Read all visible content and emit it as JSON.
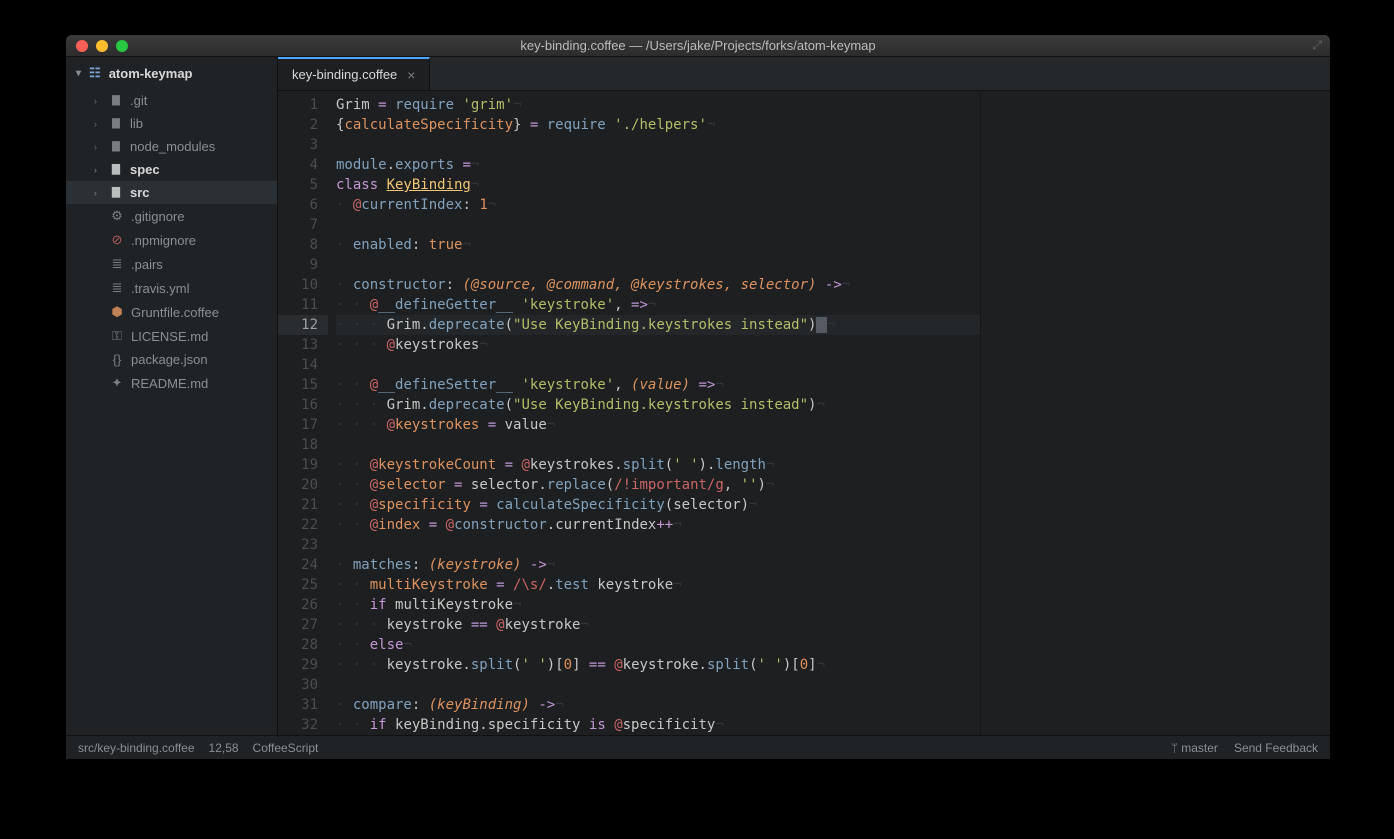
{
  "window": {
    "title": "key-binding.coffee — /Users/jake/Projects/forks/atom-keymap"
  },
  "sidebar": {
    "project": "atom-keymap",
    "items": [
      {
        "type": "folder",
        "label": ".git",
        "expanded": false
      },
      {
        "type": "folder",
        "label": "lib",
        "expanded": false
      },
      {
        "type": "folder",
        "label": "node_modules",
        "expanded": false
      },
      {
        "type": "folder",
        "label": "spec",
        "expanded": false,
        "bold": true
      },
      {
        "type": "folder",
        "label": "src",
        "expanded": false,
        "bold": true,
        "selected": true
      },
      {
        "type": "file",
        "label": ".gitignore",
        "icon": "⚙"
      },
      {
        "type": "file",
        "label": ".npmignore",
        "icon": "⊘",
        "iconcolor": "#cc6666"
      },
      {
        "type": "file",
        "label": ".pairs",
        "icon": "≣"
      },
      {
        "type": "file",
        "label": ".travis.yml",
        "icon": "≣"
      },
      {
        "type": "file",
        "label": "Gruntfile.coffee",
        "icon": "⬢",
        "iconcolor": "#de935f"
      },
      {
        "type": "file",
        "label": "LICENSE.md",
        "icon": "⚿"
      },
      {
        "type": "file",
        "label": "package.json",
        "icon": "{}"
      },
      {
        "type": "file",
        "label": "README.md",
        "icon": "✦"
      }
    ]
  },
  "tab": {
    "label": "key-binding.coffee"
  },
  "editor": {
    "current_line": 12,
    "lines": [
      [
        {
          "c": "plain",
          "t": "Grim "
        },
        {
          "c": "op",
          "t": "= "
        },
        {
          "c": "fn",
          "t": "require "
        },
        {
          "c": "str",
          "t": "'grim'"
        },
        {
          "c": "nl",
          "t": "¬"
        }
      ],
      [
        {
          "c": "plain",
          "t": "{"
        },
        {
          "c": "varn",
          "t": "calculateSpecificity"
        },
        {
          "c": "plain",
          "t": "} "
        },
        {
          "c": "op",
          "t": "= "
        },
        {
          "c": "fn",
          "t": "require "
        },
        {
          "c": "str",
          "t": "'./helpers'"
        },
        {
          "c": "nl",
          "t": "¬"
        }
      ],
      [],
      [
        {
          "c": "fn",
          "t": "module"
        },
        {
          "c": "plain",
          "t": "."
        },
        {
          "c": "fn",
          "t": "exports "
        },
        {
          "c": "op",
          "t": "="
        },
        {
          "c": "nl",
          "t": "¬"
        }
      ],
      [
        {
          "c": "kw",
          "t": "class "
        },
        {
          "c": "classname",
          "t": "KeyBinding"
        },
        {
          "c": "nl",
          "t": "¬"
        }
      ],
      [
        {
          "c": "indent",
          "t": "· "
        },
        {
          "c": "at",
          "t": "@"
        },
        {
          "c": "fn",
          "t": "currentIndex"
        },
        {
          "c": "plain",
          "t": ": "
        },
        {
          "c": "num",
          "t": "1"
        },
        {
          "c": "nl",
          "t": "¬"
        }
      ],
      [],
      [
        {
          "c": "indent",
          "t": "· "
        },
        {
          "c": "fn",
          "t": "enabled"
        },
        {
          "c": "plain",
          "t": ": "
        },
        {
          "c": "bool",
          "t": "true"
        },
        {
          "c": "nl",
          "t": "¬"
        }
      ],
      [],
      [
        {
          "c": "indent",
          "t": "· "
        },
        {
          "c": "fn",
          "t": "constructor"
        },
        {
          "c": "plain",
          "t": ": "
        },
        {
          "c": "var",
          "t": "(@source, @command, @keystrokes, selector)"
        },
        {
          "c": "plain",
          "t": " "
        },
        {
          "c": "op",
          "t": "->"
        },
        {
          "c": "nl",
          "t": "¬"
        }
      ],
      [
        {
          "c": "indent",
          "t": "· · "
        },
        {
          "c": "at",
          "t": "@"
        },
        {
          "c": "fn",
          "t": "__defineGetter__ "
        },
        {
          "c": "str",
          "t": "'keystroke'"
        },
        {
          "c": "plain",
          "t": ", "
        },
        {
          "c": "op",
          "t": "=>"
        },
        {
          "c": "nl",
          "t": "¬"
        }
      ],
      [
        {
          "c": "indent",
          "t": "· · · "
        },
        {
          "c": "plain",
          "t": "Grim."
        },
        {
          "c": "fn",
          "t": "deprecate"
        },
        {
          "c": "plain",
          "t": "("
        },
        {
          "c": "str",
          "t": "\"Use KeyBinding.keystrokes instead\""
        },
        {
          "c": "plain",
          "t": ")"
        },
        {
          "c": "cursor-cell",
          "t": " "
        },
        {
          "c": "nl",
          "t": "¬"
        }
      ],
      [
        {
          "c": "indent",
          "t": "· · · "
        },
        {
          "c": "at",
          "t": "@"
        },
        {
          "c": "plain",
          "t": "keystrokes"
        },
        {
          "c": "nl",
          "t": "¬"
        }
      ],
      [],
      [
        {
          "c": "indent",
          "t": "· · "
        },
        {
          "c": "at",
          "t": "@"
        },
        {
          "c": "fn",
          "t": "__defineSetter__ "
        },
        {
          "c": "str",
          "t": "'keystroke'"
        },
        {
          "c": "plain",
          "t": ", "
        },
        {
          "c": "var",
          "t": "(value)"
        },
        {
          "c": "plain",
          "t": " "
        },
        {
          "c": "op",
          "t": "=>"
        },
        {
          "c": "nl",
          "t": "¬"
        }
      ],
      [
        {
          "c": "indent",
          "t": "· · · "
        },
        {
          "c": "plain",
          "t": "Grim."
        },
        {
          "c": "fn",
          "t": "deprecate"
        },
        {
          "c": "plain",
          "t": "("
        },
        {
          "c": "str",
          "t": "\"Use KeyBinding.keystrokes instead\""
        },
        {
          "c": "plain",
          "t": ")"
        },
        {
          "c": "nl",
          "t": "¬"
        }
      ],
      [
        {
          "c": "indent",
          "t": "· · · "
        },
        {
          "c": "at",
          "t": "@"
        },
        {
          "c": "varn",
          "t": "keystrokes"
        },
        {
          "c": "plain",
          "t": " "
        },
        {
          "c": "op",
          "t": "="
        },
        {
          "c": "plain",
          "t": " value"
        },
        {
          "c": "nl",
          "t": "¬"
        }
      ],
      [],
      [
        {
          "c": "indent",
          "t": "· · "
        },
        {
          "c": "at",
          "t": "@"
        },
        {
          "c": "varn",
          "t": "keystrokeCount"
        },
        {
          "c": "plain",
          "t": " "
        },
        {
          "c": "op",
          "t": "="
        },
        {
          "c": "plain",
          "t": " "
        },
        {
          "c": "at",
          "t": "@"
        },
        {
          "c": "plain",
          "t": "keystrokes."
        },
        {
          "c": "fn",
          "t": "split"
        },
        {
          "c": "plain",
          "t": "("
        },
        {
          "c": "str",
          "t": "' '"
        },
        {
          "c": "plain",
          "t": ")."
        },
        {
          "c": "fn",
          "t": "length"
        },
        {
          "c": "nl",
          "t": "¬"
        }
      ],
      [
        {
          "c": "indent",
          "t": "· · "
        },
        {
          "c": "at",
          "t": "@"
        },
        {
          "c": "varn",
          "t": "selector"
        },
        {
          "c": "plain",
          "t": " "
        },
        {
          "c": "op",
          "t": "="
        },
        {
          "c": "plain",
          "t": " selector."
        },
        {
          "c": "fn",
          "t": "replace"
        },
        {
          "c": "plain",
          "t": "("
        },
        {
          "c": "reg",
          "t": "/!important/g"
        },
        {
          "c": "plain",
          "t": ", "
        },
        {
          "c": "str",
          "t": "''"
        },
        {
          "c": "plain",
          "t": ")"
        },
        {
          "c": "nl",
          "t": "¬"
        }
      ],
      [
        {
          "c": "indent",
          "t": "· · "
        },
        {
          "c": "at",
          "t": "@"
        },
        {
          "c": "varn",
          "t": "specificity"
        },
        {
          "c": "plain",
          "t": " "
        },
        {
          "c": "op",
          "t": "="
        },
        {
          "c": "plain",
          "t": " "
        },
        {
          "c": "fn",
          "t": "calculateSpecificity"
        },
        {
          "c": "plain",
          "t": "(selector)"
        },
        {
          "c": "nl",
          "t": "¬"
        }
      ],
      [
        {
          "c": "indent",
          "t": "· · "
        },
        {
          "c": "at",
          "t": "@"
        },
        {
          "c": "varn",
          "t": "index"
        },
        {
          "c": "plain",
          "t": " "
        },
        {
          "c": "op",
          "t": "="
        },
        {
          "c": "plain",
          "t": " "
        },
        {
          "c": "at",
          "t": "@"
        },
        {
          "c": "fn",
          "t": "constructor"
        },
        {
          "c": "plain",
          "t": ".currentIndex"
        },
        {
          "c": "op",
          "t": "++"
        },
        {
          "c": "nl",
          "t": "¬"
        }
      ],
      [],
      [
        {
          "c": "indent",
          "t": "· "
        },
        {
          "c": "fn",
          "t": "matches"
        },
        {
          "c": "plain",
          "t": ": "
        },
        {
          "c": "var",
          "t": "(keystroke)"
        },
        {
          "c": "plain",
          "t": " "
        },
        {
          "c": "op",
          "t": "->"
        },
        {
          "c": "nl",
          "t": "¬"
        }
      ],
      [
        {
          "c": "indent",
          "t": "· · "
        },
        {
          "c": "varn",
          "t": "multiKeystroke"
        },
        {
          "c": "plain",
          "t": " "
        },
        {
          "c": "op",
          "t": "="
        },
        {
          "c": "plain",
          "t": " "
        },
        {
          "c": "reg",
          "t": "/\\s/"
        },
        {
          "c": "plain",
          "t": "."
        },
        {
          "c": "fn",
          "t": "test"
        },
        {
          "c": "plain",
          "t": " keystroke"
        },
        {
          "c": "nl",
          "t": "¬"
        }
      ],
      [
        {
          "c": "indent",
          "t": "· · "
        },
        {
          "c": "kw",
          "t": "if "
        },
        {
          "c": "plain",
          "t": "multiKeystroke"
        },
        {
          "c": "nl",
          "t": "¬"
        }
      ],
      [
        {
          "c": "indent",
          "t": "· · · "
        },
        {
          "c": "plain",
          "t": "keystroke "
        },
        {
          "c": "op",
          "t": "=="
        },
        {
          "c": "plain",
          "t": " "
        },
        {
          "c": "at",
          "t": "@"
        },
        {
          "c": "plain",
          "t": "keystroke"
        },
        {
          "c": "nl",
          "t": "¬"
        }
      ],
      [
        {
          "c": "indent",
          "t": "· · "
        },
        {
          "c": "kw",
          "t": "else"
        },
        {
          "c": "nl",
          "t": "¬"
        }
      ],
      [
        {
          "c": "indent",
          "t": "· · · "
        },
        {
          "c": "plain",
          "t": "keystroke."
        },
        {
          "c": "fn",
          "t": "split"
        },
        {
          "c": "plain",
          "t": "("
        },
        {
          "c": "str",
          "t": "' '"
        },
        {
          "c": "plain",
          "t": ")["
        },
        {
          "c": "num",
          "t": "0"
        },
        {
          "c": "plain",
          "t": "] "
        },
        {
          "c": "op",
          "t": "=="
        },
        {
          "c": "plain",
          "t": " "
        },
        {
          "c": "at",
          "t": "@"
        },
        {
          "c": "plain",
          "t": "keystroke."
        },
        {
          "c": "fn",
          "t": "split"
        },
        {
          "c": "plain",
          "t": "("
        },
        {
          "c": "str",
          "t": "' '"
        },
        {
          "c": "plain",
          "t": ")["
        },
        {
          "c": "num",
          "t": "0"
        },
        {
          "c": "plain",
          "t": "]"
        },
        {
          "c": "nl",
          "t": "¬"
        }
      ],
      [],
      [
        {
          "c": "indent",
          "t": "· "
        },
        {
          "c": "fn",
          "t": "compare"
        },
        {
          "c": "plain",
          "t": ": "
        },
        {
          "c": "var",
          "t": "(keyBinding)"
        },
        {
          "c": "plain",
          "t": " "
        },
        {
          "c": "op",
          "t": "->"
        },
        {
          "c": "nl",
          "t": "¬"
        }
      ],
      [
        {
          "c": "indent",
          "t": "· · "
        },
        {
          "c": "kw",
          "t": "if "
        },
        {
          "c": "plain",
          "t": "keyBinding.specificity "
        },
        {
          "c": "kw",
          "t": "is "
        },
        {
          "c": "at",
          "t": "@"
        },
        {
          "c": "plain",
          "t": "specificity"
        },
        {
          "c": "nl",
          "t": "¬"
        }
      ]
    ]
  },
  "status": {
    "path": "src/key-binding.coffee",
    "pos": "12,58",
    "lang": "CoffeeScript",
    "branch": "master",
    "feedback": "Send Feedback"
  }
}
